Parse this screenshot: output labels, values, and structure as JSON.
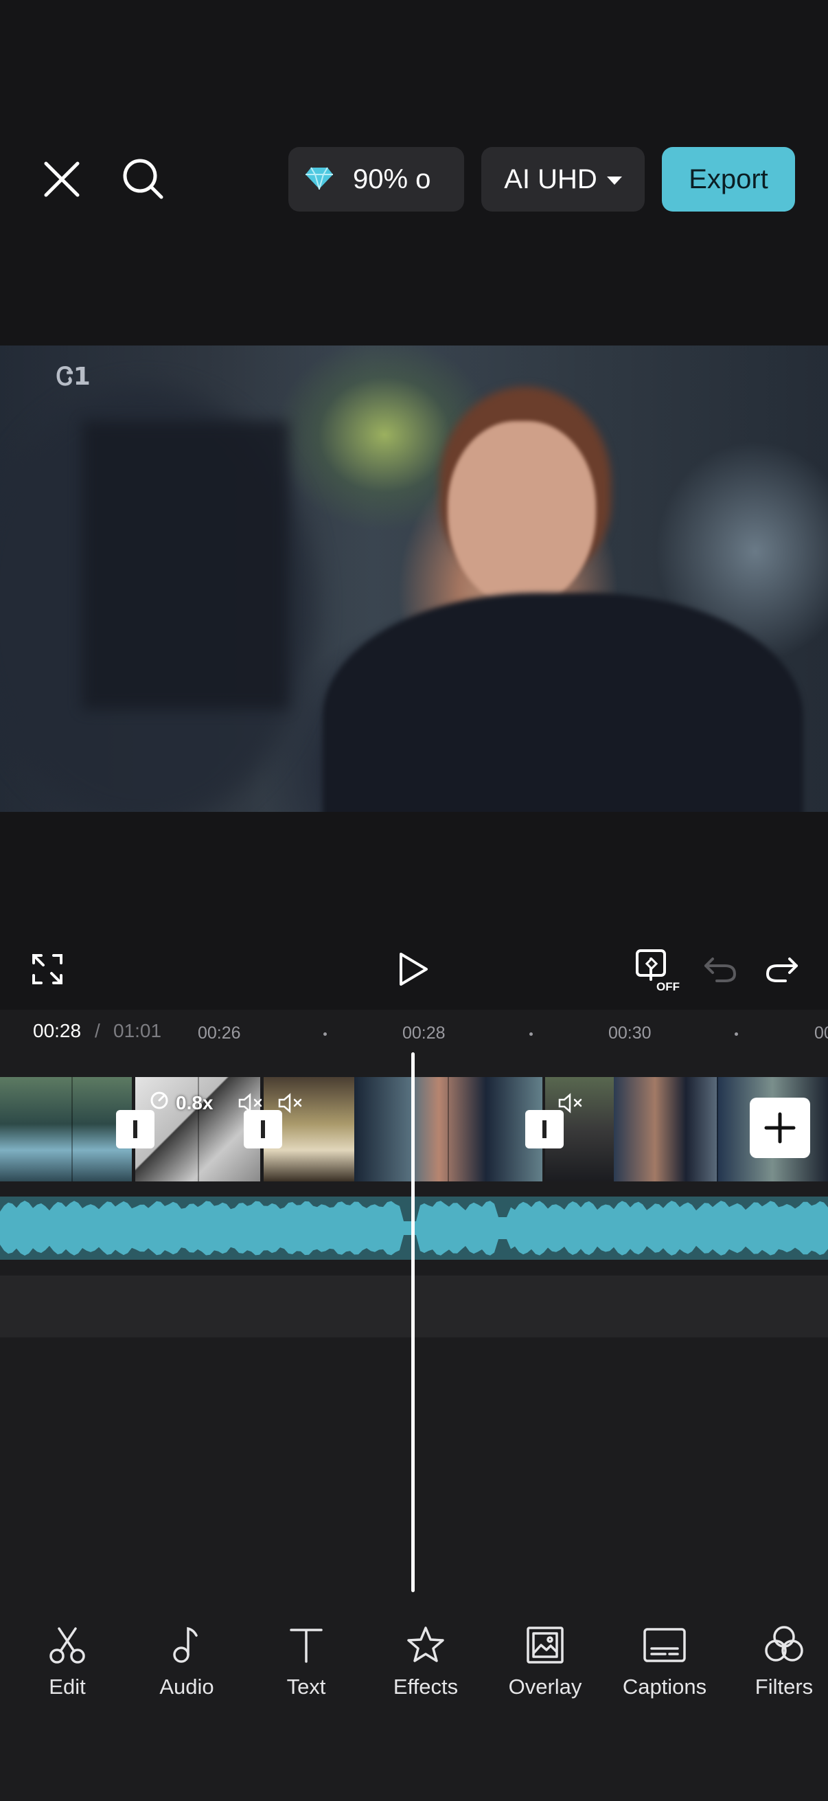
{
  "header": {
    "close_icon": "close-icon",
    "search_icon": "search-icon",
    "pro_badge": {
      "icon": "diamond-icon",
      "label": "90% o",
      "color": "#4ec8e0"
    },
    "resolution": {
      "label": "AI UHD"
    },
    "export_label": "Export",
    "export_color": "#55c2d6"
  },
  "preview": {
    "logo_text": "Ꮳ1"
  },
  "player": {
    "fullscreen_icon": "fullscreen-icon",
    "play_icon": "play-icon",
    "keyframe_icon": "keyframe-off-icon",
    "keyframe_state": "OFF",
    "undo_icon": "undo-icon",
    "redo_icon": "redo-icon"
  },
  "timeline": {
    "current_time": "00:28",
    "separator": "/",
    "total_time": "01:01",
    "ticks": [
      "00:26",
      "00:28",
      "00:30",
      "00"
    ],
    "speed_label": "0.8x",
    "audio_color": "#4fb1c4"
  },
  "toolbar": {
    "items": [
      {
        "label": "Edit",
        "icon": "scissors-icon"
      },
      {
        "label": "Audio",
        "icon": "music-note-icon"
      },
      {
        "label": "Text",
        "icon": "text-icon"
      },
      {
        "label": "Effects",
        "icon": "star-icon"
      },
      {
        "label": "Overlay",
        "icon": "overlay-icon"
      },
      {
        "label": "Captions",
        "icon": "captions-icon"
      },
      {
        "label": "Filters",
        "icon": "filters-icon"
      }
    ]
  }
}
